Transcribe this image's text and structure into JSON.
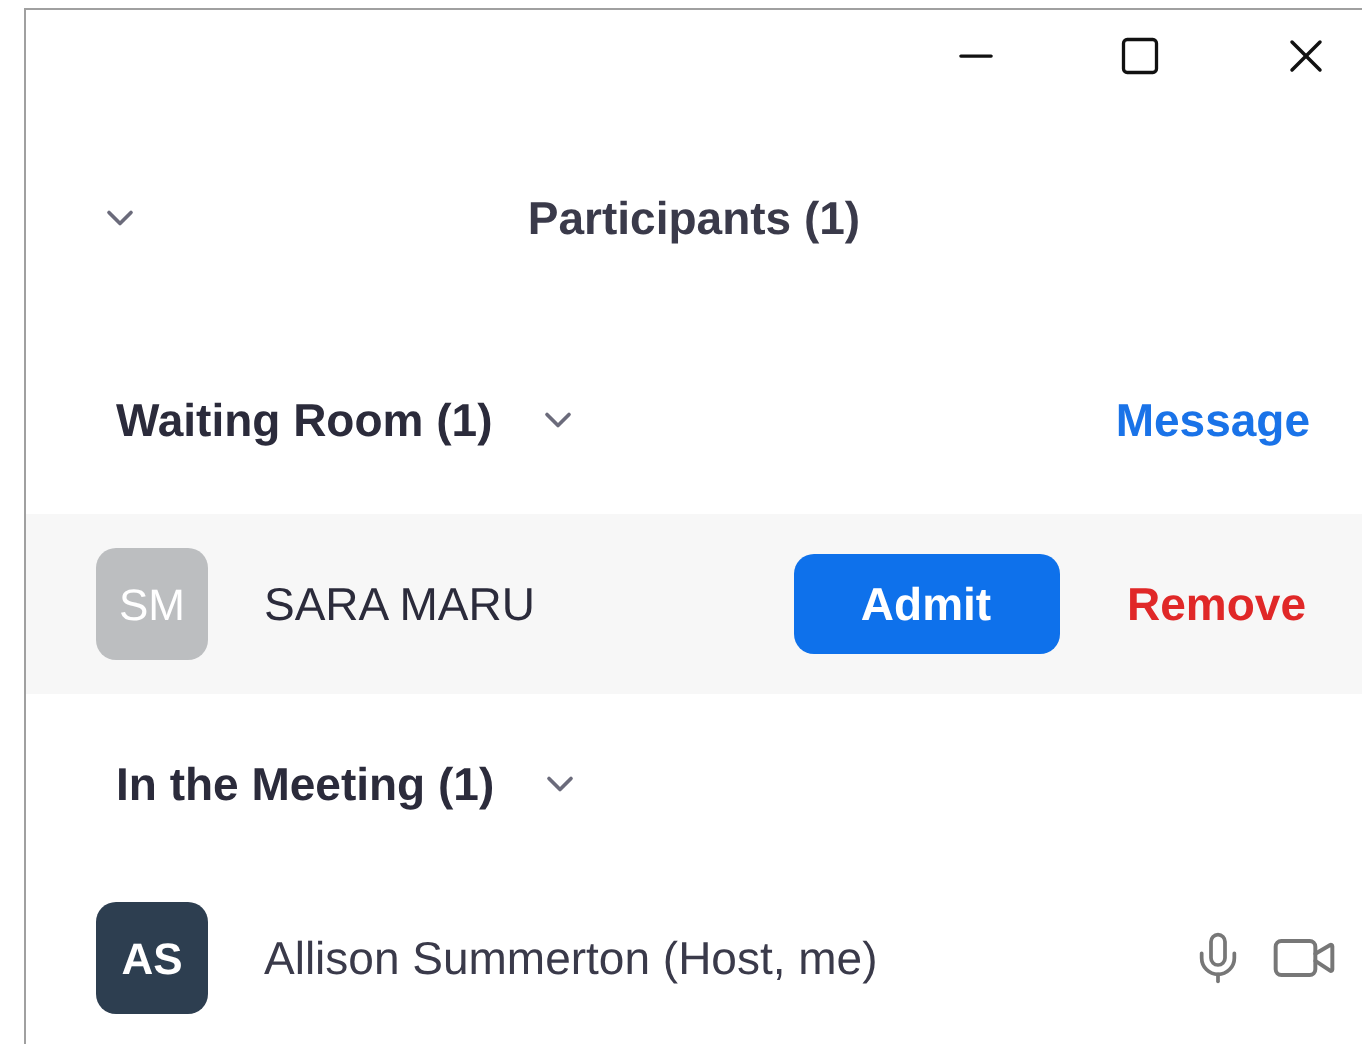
{
  "window": {
    "title": "Participants (1)"
  },
  "waiting_room": {
    "heading": "Waiting Room (1)",
    "message_link": "Message",
    "participants": [
      {
        "initials": "SM",
        "name": "SARA MARU",
        "color": "#bcbec0",
        "admit": "Admit",
        "remove": "Remove"
      }
    ]
  },
  "meeting": {
    "heading": "In the Meeting (1)",
    "participants": [
      {
        "initials": "AS",
        "name": "Allison Summerton (Host, me)",
        "color": "#2d3e50"
      }
    ]
  }
}
